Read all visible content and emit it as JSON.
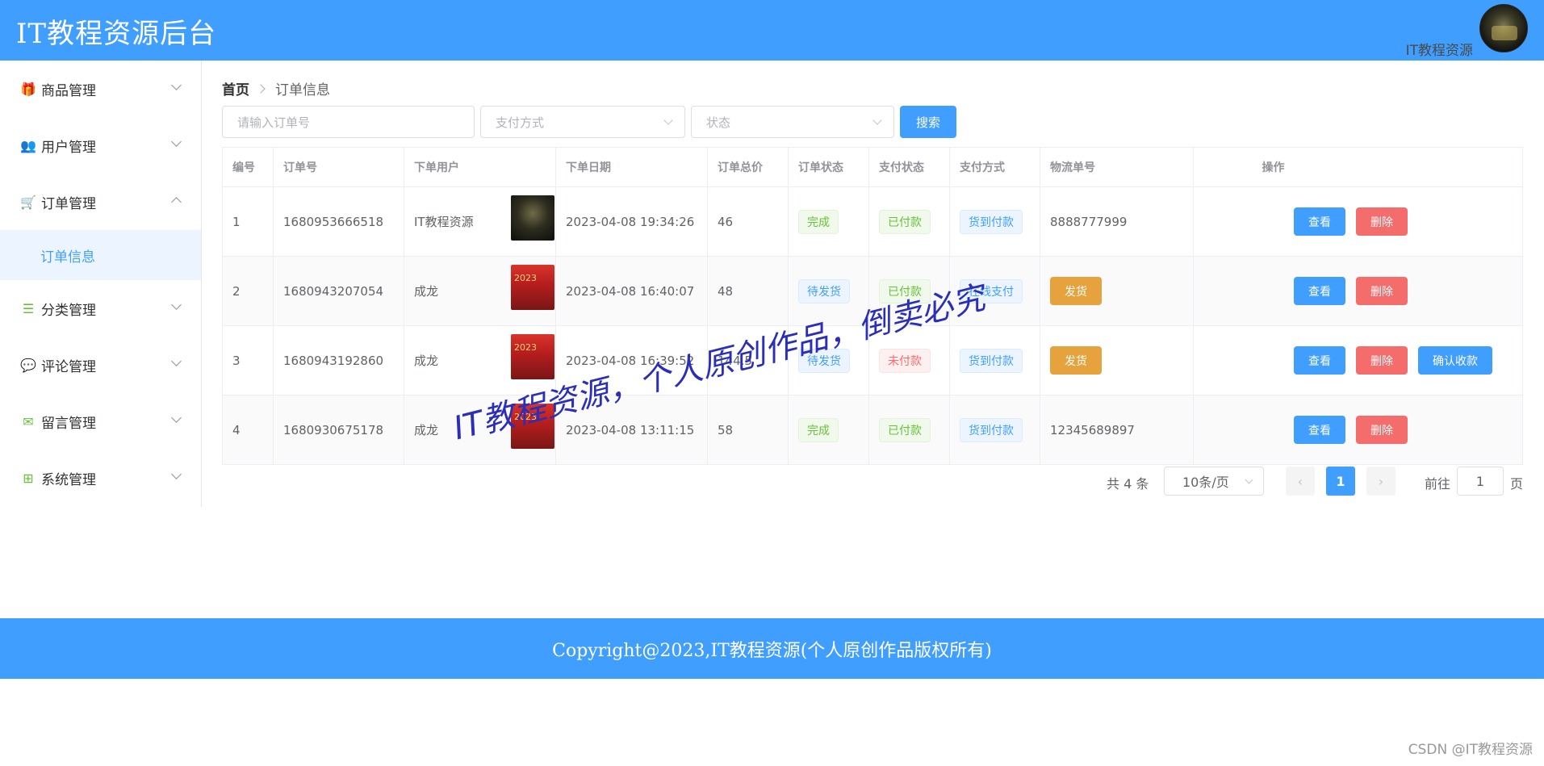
{
  "header": {
    "title": "IT教程资源后台",
    "username": "IT教程资源"
  },
  "sidebar": {
    "items": [
      {
        "label": "商品管理",
        "icon": "gift-icon"
      },
      {
        "label": "用户管理",
        "icon": "users-icon"
      },
      {
        "label": "订单管理",
        "icon": "cart-icon",
        "expanded": true,
        "sub": [
          {
            "label": "订单信息",
            "active": true
          }
        ]
      },
      {
        "label": "分类管理",
        "icon": "list-icon"
      },
      {
        "label": "评论管理",
        "icon": "comments-icon"
      },
      {
        "label": "留言管理",
        "icon": "message-icon"
      },
      {
        "label": "系统管理",
        "icon": "windows-icon"
      }
    ]
  },
  "breadcrumb": {
    "home": "首页",
    "current": "订单信息"
  },
  "filters": {
    "order_placeholder": "请输入订单号",
    "payment_placeholder": "支付方式",
    "status_placeholder": "状态",
    "search_label": "搜索"
  },
  "table": {
    "headers": [
      "编号",
      "订单号",
      "下单用户",
      "下单日期",
      "订单总价",
      "订单状态",
      "支付状态",
      "支付方式",
      "物流单号",
      "操作"
    ],
    "rows": [
      {
        "id": "1",
        "order_no": "1680953666518",
        "user": "IT教程资源",
        "date": "2023-04-08 19:34:26",
        "total": "46",
        "order_status": "完成",
        "pay_status": "已付款",
        "pay_method": "货到付款",
        "logistics": "8888777999"
      },
      {
        "id": "2",
        "order_no": "1680943207054",
        "user": "成龙",
        "date": "2023-04-08 16:40:07",
        "total": "48",
        "order_status": "待发货",
        "pay_status": "已付款",
        "pay_method": "在线支付",
        "ship_label": "发货"
      },
      {
        "id": "3",
        "order_no": "1680943192860",
        "user": "成龙",
        "date": "2023-04-08 16:39:52",
        "total": "144.5",
        "order_status": "待发货",
        "pay_status": "未付款",
        "pay_method": "货到付款",
        "ship_label": "发货",
        "confirm_label": "确认收款"
      },
      {
        "id": "4",
        "order_no": "1680930675178",
        "user": "成龙",
        "date": "2023-04-08 13:11:15",
        "total": "58",
        "order_status": "完成",
        "pay_status": "已付款",
        "pay_method": "货到付款",
        "logistics": "12345689897"
      }
    ],
    "view_label": "查看",
    "delete_label": "删除"
  },
  "pagination": {
    "total": "共 4 条",
    "page_size": "10条/页",
    "prev": "‹",
    "current_page": "1",
    "next": "›",
    "goto_prefix": "前往",
    "goto_value": "1",
    "goto_suffix": "页"
  },
  "watermark": "IT教程资源，个人原创作品，倒卖必究",
  "footer": {
    "copyright": "Copyright@2023,IT教程资源(个人原创作品版权所有)"
  },
  "csdn": "CSDN @IT教程资源",
  "colors": {
    "primary": "#409eff",
    "success": "#67c23a",
    "danger": "#f56c6c",
    "warning": "#e6a23c"
  }
}
